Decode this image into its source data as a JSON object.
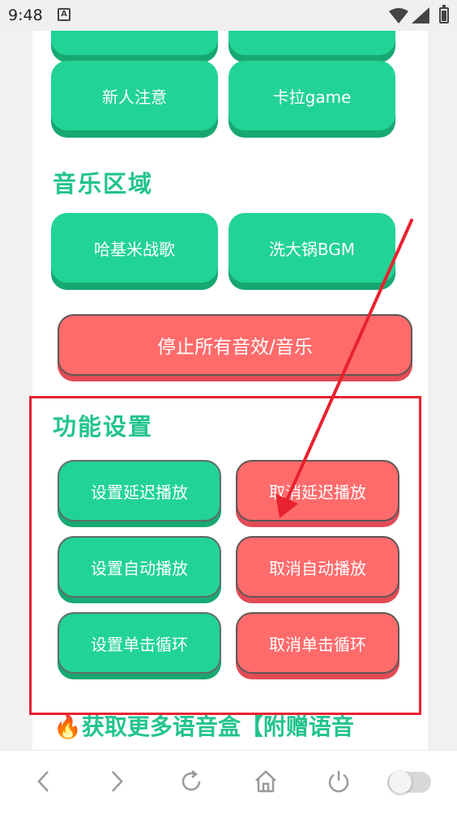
{
  "status_bar": {
    "time": "9:48",
    "notification_letter": "A",
    "icons": [
      "wifi-icon",
      "signal-icon",
      "battery-icon"
    ]
  },
  "grid_top": {
    "row0": [
      "",
      ""
    ],
    "row1": [
      "新人注意",
      "卡拉game"
    ]
  },
  "music_section": {
    "title": "音乐区域",
    "buttons": [
      "哈基米战歌",
      "洗大锅BGM"
    ],
    "stop_all": "停止所有音效/音乐"
  },
  "settings_section": {
    "title": "功能设置",
    "set_delay": "设置延迟播放",
    "cancel_delay": "取消延迟播放",
    "set_auto": "设置自动播放",
    "cancel_auto": "取消自动播放",
    "set_loop": "设置单击循环",
    "cancel_loop": "取消单击循环"
  },
  "promo": {
    "icon": "fire-icon",
    "text": "获取更多语音盒【附赠语音"
  },
  "bottom_nav": [
    "back-icon",
    "forward-icon",
    "refresh-icon",
    "home-icon",
    "power-icon",
    "toggle-switch"
  ],
  "colors": {
    "accent_green": "#22d396",
    "accent_red": "#ff6b6b",
    "annotation_red": "#e8222f"
  }
}
